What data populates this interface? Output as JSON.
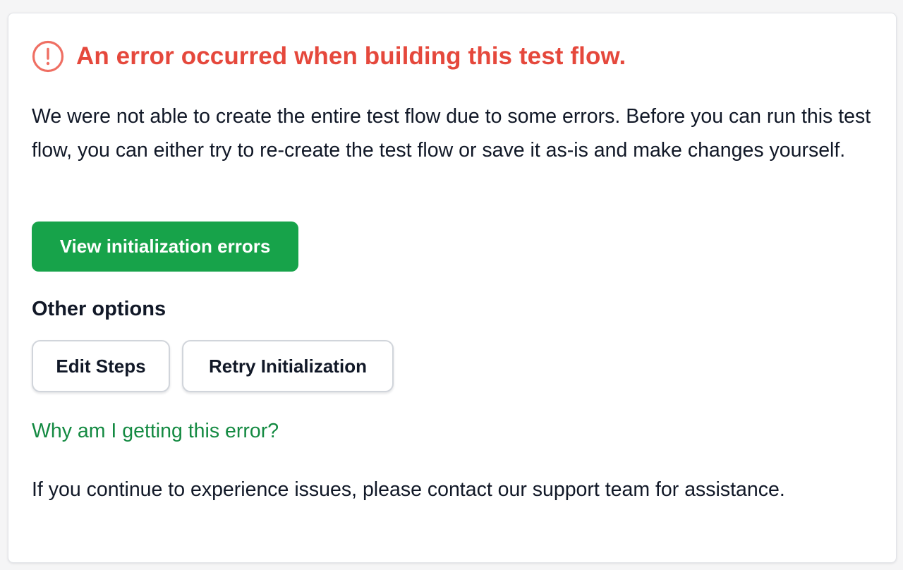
{
  "colors": {
    "error": "#e5483c",
    "primary": "#17a34a",
    "link": "#148a42",
    "text": "#111827"
  },
  "alert": {
    "icon": "alert-circle-icon",
    "title": "An error occurred when building this test flow.",
    "description": "We were not able to create the entire test flow due to some errors. Before you can run this test flow, you can either try to re-create the test flow or save it as-is and make changes yourself."
  },
  "actions": {
    "primary_label": "View initialization errors",
    "other_options_heading": "Other options",
    "edit_steps_label": "Edit Steps",
    "retry_label": "Retry Initialization"
  },
  "help": {
    "link_text": "Why am I getting this error?",
    "support_text": "If you continue to experience issues, please contact our support team for assistance."
  }
}
